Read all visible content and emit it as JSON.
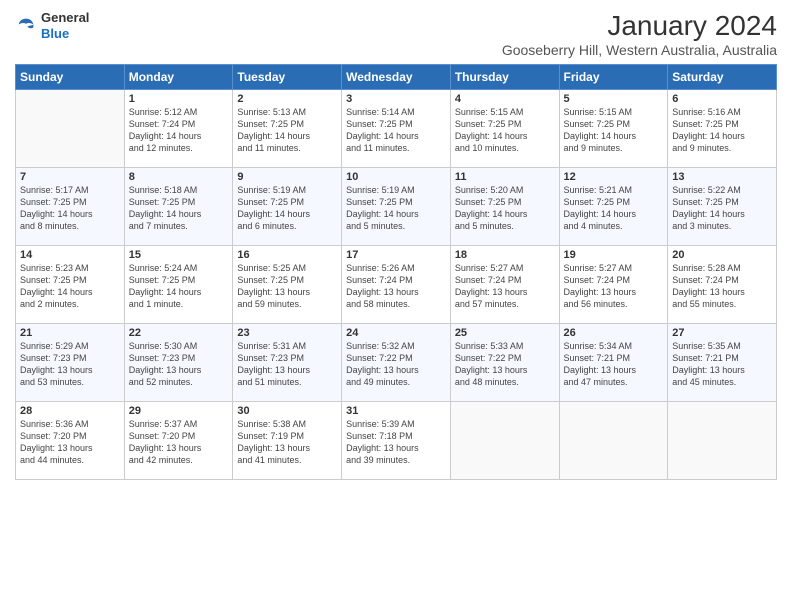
{
  "logo": {
    "general": "General",
    "blue": "Blue"
  },
  "header": {
    "title": "January 2024",
    "location": "Gooseberry Hill, Western Australia, Australia"
  },
  "days_of_week": [
    "Sunday",
    "Monday",
    "Tuesday",
    "Wednesday",
    "Thursday",
    "Friday",
    "Saturday"
  ],
  "weeks": [
    [
      {
        "day": "",
        "info": ""
      },
      {
        "day": "1",
        "info": "Sunrise: 5:12 AM\nSunset: 7:24 PM\nDaylight: 14 hours\nand 12 minutes."
      },
      {
        "day": "2",
        "info": "Sunrise: 5:13 AM\nSunset: 7:25 PM\nDaylight: 14 hours\nand 11 minutes."
      },
      {
        "day": "3",
        "info": "Sunrise: 5:14 AM\nSunset: 7:25 PM\nDaylight: 14 hours\nand 11 minutes."
      },
      {
        "day": "4",
        "info": "Sunrise: 5:15 AM\nSunset: 7:25 PM\nDaylight: 14 hours\nand 10 minutes."
      },
      {
        "day": "5",
        "info": "Sunrise: 5:15 AM\nSunset: 7:25 PM\nDaylight: 14 hours\nand 9 minutes."
      },
      {
        "day": "6",
        "info": "Sunrise: 5:16 AM\nSunset: 7:25 PM\nDaylight: 14 hours\nand 9 minutes."
      }
    ],
    [
      {
        "day": "7",
        "info": "Sunrise: 5:17 AM\nSunset: 7:25 PM\nDaylight: 14 hours\nand 8 minutes."
      },
      {
        "day": "8",
        "info": "Sunrise: 5:18 AM\nSunset: 7:25 PM\nDaylight: 14 hours\nand 7 minutes."
      },
      {
        "day": "9",
        "info": "Sunrise: 5:19 AM\nSunset: 7:25 PM\nDaylight: 14 hours\nand 6 minutes."
      },
      {
        "day": "10",
        "info": "Sunrise: 5:19 AM\nSunset: 7:25 PM\nDaylight: 14 hours\nand 5 minutes."
      },
      {
        "day": "11",
        "info": "Sunrise: 5:20 AM\nSunset: 7:25 PM\nDaylight: 14 hours\nand 5 minutes."
      },
      {
        "day": "12",
        "info": "Sunrise: 5:21 AM\nSunset: 7:25 PM\nDaylight: 14 hours\nand 4 minutes."
      },
      {
        "day": "13",
        "info": "Sunrise: 5:22 AM\nSunset: 7:25 PM\nDaylight: 14 hours\nand 3 minutes."
      }
    ],
    [
      {
        "day": "14",
        "info": "Sunrise: 5:23 AM\nSunset: 7:25 PM\nDaylight: 14 hours\nand 2 minutes."
      },
      {
        "day": "15",
        "info": "Sunrise: 5:24 AM\nSunset: 7:25 PM\nDaylight: 14 hours\nand 1 minute."
      },
      {
        "day": "16",
        "info": "Sunrise: 5:25 AM\nSunset: 7:25 PM\nDaylight: 13 hours\nand 59 minutes."
      },
      {
        "day": "17",
        "info": "Sunrise: 5:26 AM\nSunset: 7:24 PM\nDaylight: 13 hours\nand 58 minutes."
      },
      {
        "day": "18",
        "info": "Sunrise: 5:27 AM\nSunset: 7:24 PM\nDaylight: 13 hours\nand 57 minutes."
      },
      {
        "day": "19",
        "info": "Sunrise: 5:27 AM\nSunset: 7:24 PM\nDaylight: 13 hours\nand 56 minutes."
      },
      {
        "day": "20",
        "info": "Sunrise: 5:28 AM\nSunset: 7:24 PM\nDaylight: 13 hours\nand 55 minutes."
      }
    ],
    [
      {
        "day": "21",
        "info": "Sunrise: 5:29 AM\nSunset: 7:23 PM\nDaylight: 13 hours\nand 53 minutes."
      },
      {
        "day": "22",
        "info": "Sunrise: 5:30 AM\nSunset: 7:23 PM\nDaylight: 13 hours\nand 52 minutes."
      },
      {
        "day": "23",
        "info": "Sunrise: 5:31 AM\nSunset: 7:23 PM\nDaylight: 13 hours\nand 51 minutes."
      },
      {
        "day": "24",
        "info": "Sunrise: 5:32 AM\nSunset: 7:22 PM\nDaylight: 13 hours\nand 49 minutes."
      },
      {
        "day": "25",
        "info": "Sunrise: 5:33 AM\nSunset: 7:22 PM\nDaylight: 13 hours\nand 48 minutes."
      },
      {
        "day": "26",
        "info": "Sunrise: 5:34 AM\nSunset: 7:21 PM\nDaylight: 13 hours\nand 47 minutes."
      },
      {
        "day": "27",
        "info": "Sunrise: 5:35 AM\nSunset: 7:21 PM\nDaylight: 13 hours\nand 45 minutes."
      }
    ],
    [
      {
        "day": "28",
        "info": "Sunrise: 5:36 AM\nSunset: 7:20 PM\nDaylight: 13 hours\nand 44 minutes."
      },
      {
        "day": "29",
        "info": "Sunrise: 5:37 AM\nSunset: 7:20 PM\nDaylight: 13 hours\nand 42 minutes."
      },
      {
        "day": "30",
        "info": "Sunrise: 5:38 AM\nSunset: 7:19 PM\nDaylight: 13 hours\nand 41 minutes."
      },
      {
        "day": "31",
        "info": "Sunrise: 5:39 AM\nSunset: 7:18 PM\nDaylight: 13 hours\nand 39 minutes."
      },
      {
        "day": "",
        "info": ""
      },
      {
        "day": "",
        "info": ""
      },
      {
        "day": "",
        "info": ""
      }
    ]
  ]
}
